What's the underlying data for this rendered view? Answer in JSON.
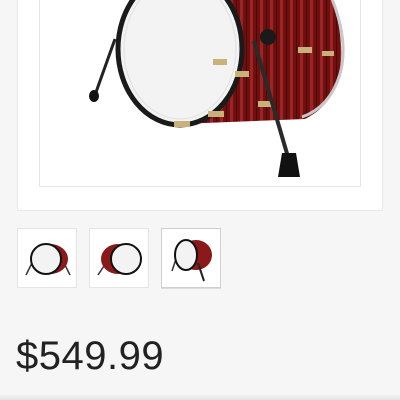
{
  "product": {
    "image_name": "bass-drum-icon",
    "price": "$549.99"
  },
  "colors": {
    "shell": "#7a1414",
    "shell_stripe": "#a52a2a",
    "hardware": "#c9b27a",
    "head": "#f2f2f2",
    "leg": "#222222",
    "price_text": "#222222"
  },
  "thumbnails": [
    {
      "name": "drum-front-view",
      "selected": false
    },
    {
      "name": "drum-side-view",
      "selected": false
    },
    {
      "name": "drum-angled-view",
      "selected": true
    }
  ]
}
